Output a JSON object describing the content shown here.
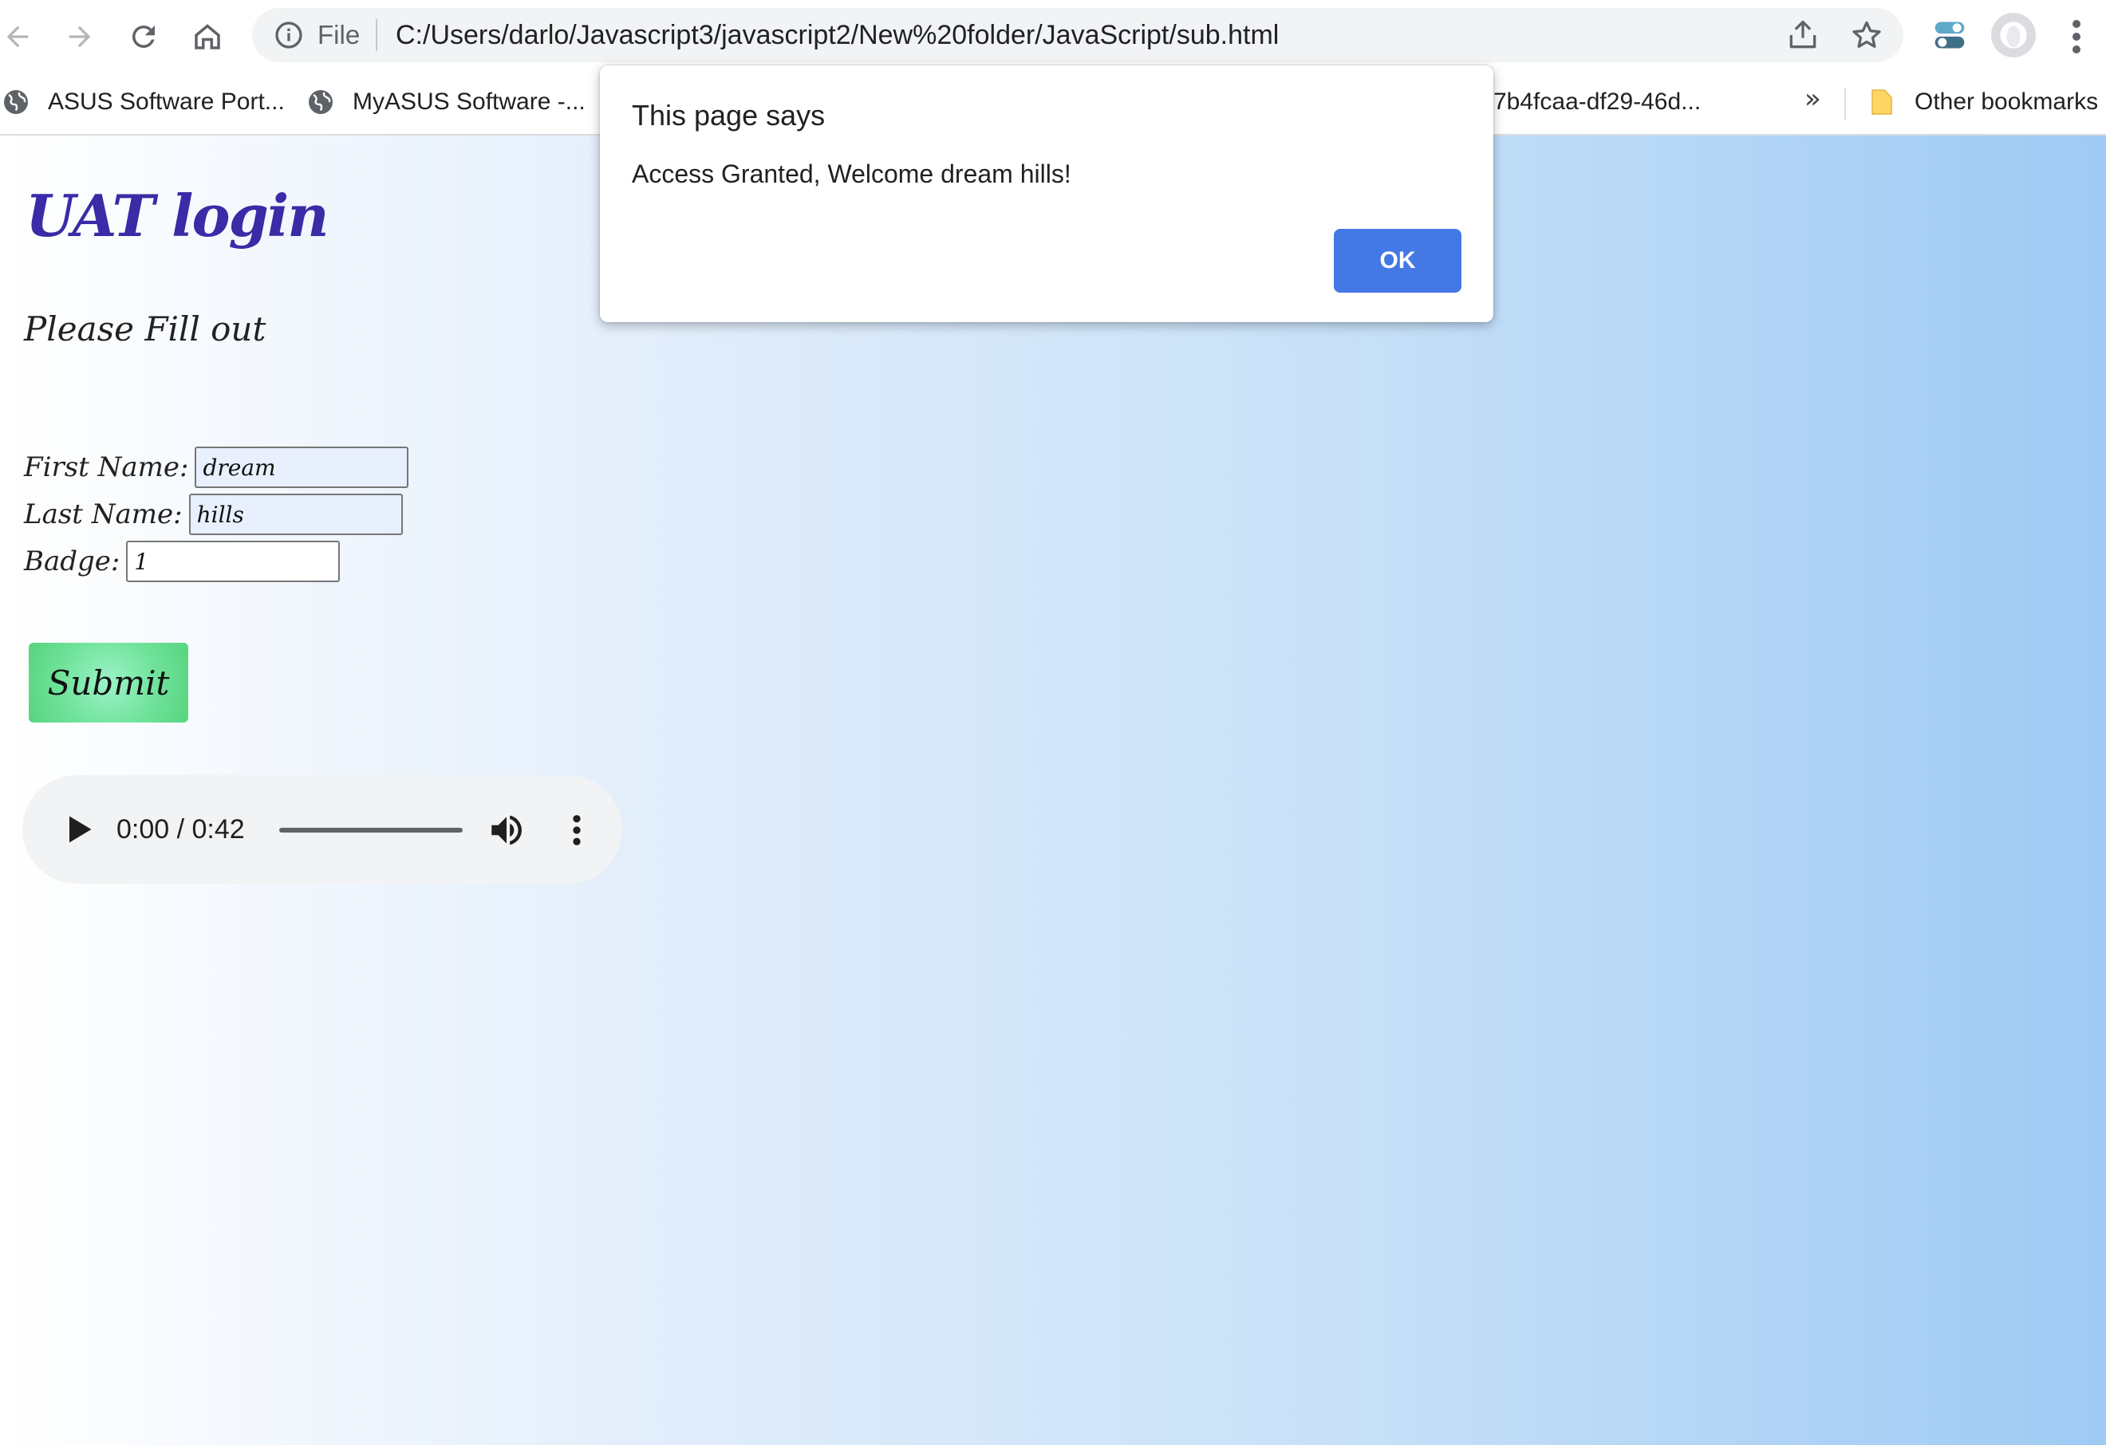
{
  "browser": {
    "address_bar": {
      "scheme_label": "File",
      "url": "C:/Users/darlo/Javascript3/javascript2/New%20folder/JavaScript/sub.html"
    },
    "bookmarks": [
      {
        "label": "ASUS Software Port...",
        "icon": "globe-icon"
      },
      {
        "label": "MyASUS Software -...",
        "icon": "globe-icon"
      },
      {
        "label": "7b4fcaa-df29-46d...",
        "icon": ""
      }
    ],
    "bookmarks_overflow": "»",
    "other_bookmarks": "Other bookmarks"
  },
  "page": {
    "title": "UAT login",
    "subtitle": "Please Fill out",
    "form": {
      "first_name_label": "First Name:",
      "first_name_value": "dream",
      "last_name_label": "Last Name:",
      "last_name_value": "hills",
      "badge_label": "Badge:",
      "badge_value": "1",
      "submit_label": "Submit"
    },
    "audio": {
      "time": "0:00 / 0:42",
      "progress": 0.0
    }
  },
  "dialog": {
    "title": "This page says",
    "message": "Access Granted, Welcome dream hills!",
    "ok_label": "OK",
    "ok_color": "#4478e4"
  }
}
